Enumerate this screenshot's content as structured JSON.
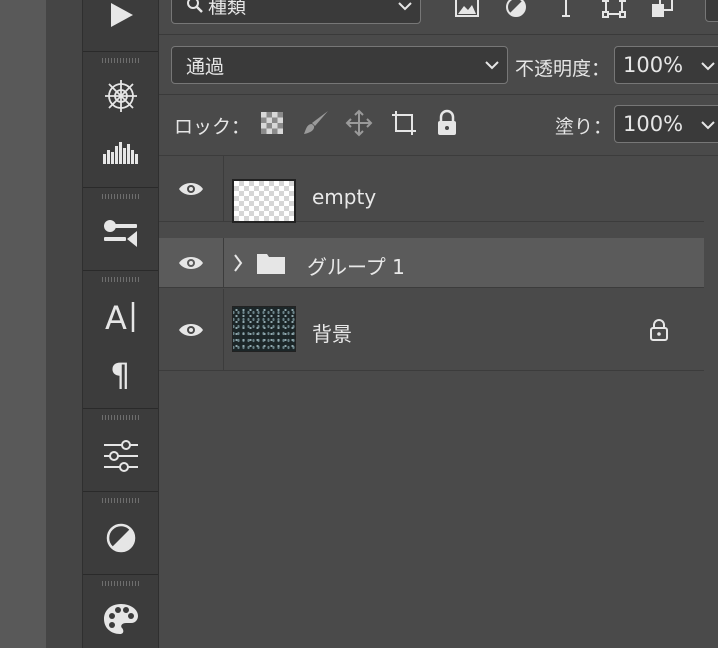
{
  "toolbar": {
    "tools": [
      {
        "name": "play-icon"
      },
      {
        "name": "network-icon"
      },
      {
        "name": "histogram-icon"
      },
      {
        "name": "brush-settings-icon"
      },
      {
        "name": "character-icon"
      },
      {
        "name": "paragraph-icon"
      },
      {
        "name": "adjustments-icon"
      },
      {
        "name": "contrast-icon"
      },
      {
        "name": "palette-icon"
      }
    ]
  },
  "filter": {
    "kind_label": "種類",
    "filter_icons": [
      "image-filter-icon",
      "adjustment-filter-icon",
      "type-filter-icon",
      "shape-filter-icon",
      "smart-object-filter-icon"
    ]
  },
  "blend": {
    "mode": "通過",
    "opacity_label": "不透明度：",
    "opacity_value": "100%"
  },
  "lock": {
    "label": "ロック：",
    "icons": [
      "lock-transparent-icon",
      "lock-image-icon",
      "lock-position-icon",
      "lock-artboard-icon",
      "lock-all-icon"
    ],
    "fill_label": "塗り：",
    "fill_value": "100%"
  },
  "layers": [
    {
      "name": "empty",
      "type": "layer",
      "thumb": "transparent",
      "visible": true,
      "locked": false
    },
    {
      "name": "グループ 1",
      "type": "group",
      "selected": true,
      "visible": true,
      "locked": false
    },
    {
      "name": "背景",
      "type": "layer",
      "thumb": "dark-texture",
      "visible": true,
      "locked": true
    }
  ],
  "colors": {
    "panel": "#4a4a4a",
    "selected_row": "#5b5b5b",
    "toolbar": "#3c3c3c"
  }
}
